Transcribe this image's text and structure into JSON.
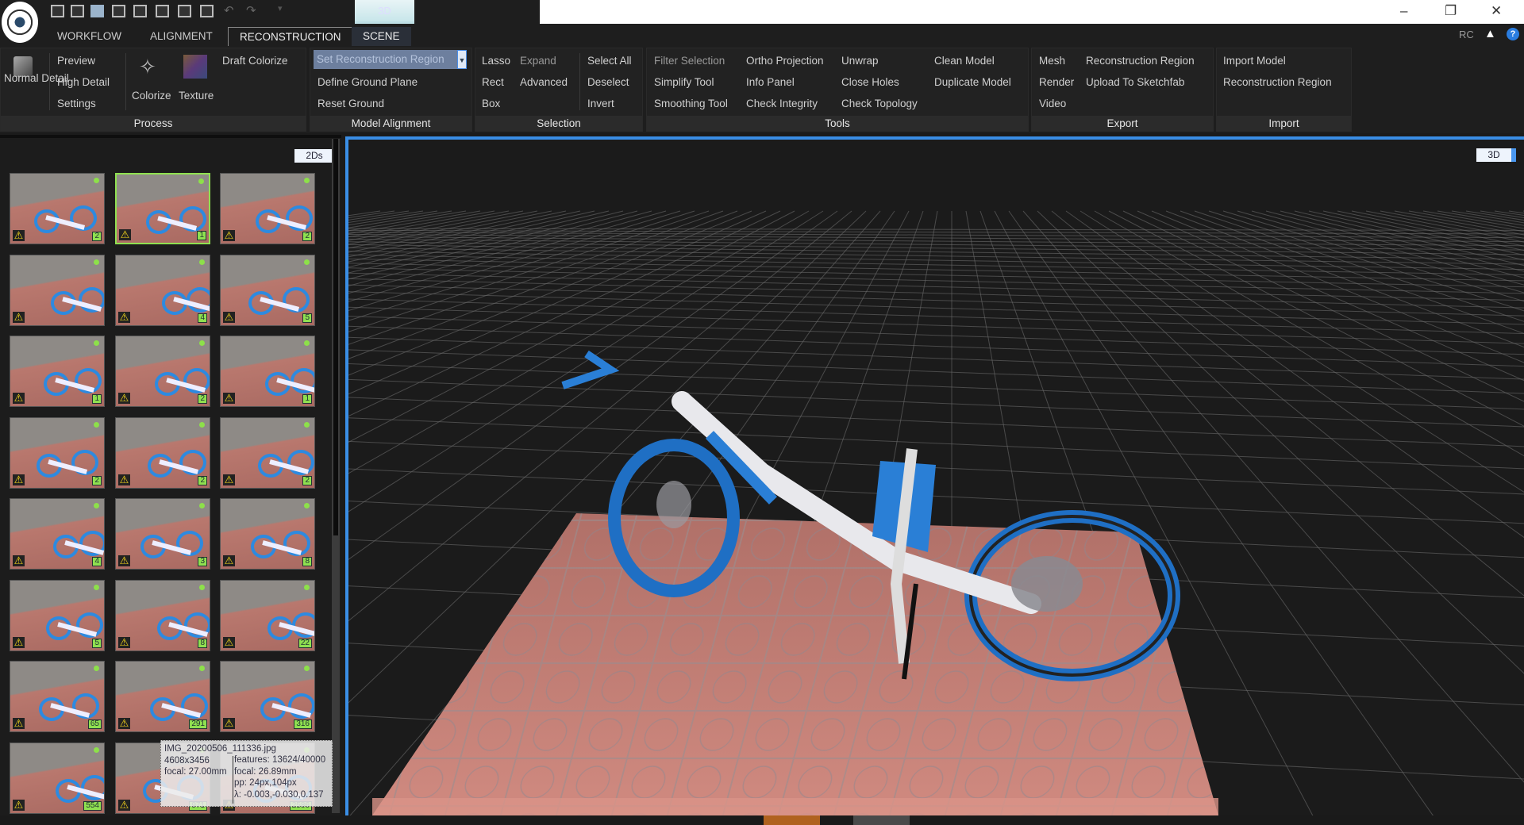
{
  "titlebar": {
    "view_tab": "3D",
    "rc_label": "RC",
    "window_controls": [
      "minimize",
      "restore",
      "close"
    ]
  },
  "tabs": [
    {
      "label": "WORKFLOW"
    },
    {
      "label": "ALIGNMENT"
    },
    {
      "label": "RECONSTRUCTION",
      "active": true
    },
    {
      "label": "SCENE"
    }
  ],
  "ribbon": {
    "process": {
      "label": "Process",
      "normal_detail": "Normal Detail",
      "preview": "Preview",
      "high_detail": "High Detail",
      "settings": "Settings",
      "colorize": "Colorize",
      "texture": "Texture",
      "draft_colorize": "Draft Colorize"
    },
    "model_alignment": {
      "label": "Model Alignment",
      "dropdown_value": "Set Reconstruction Region",
      "define_ground": "Define Ground Plane",
      "reset_ground": "Reset Ground"
    },
    "selection": {
      "label": "Selection",
      "lasso": "Lasso",
      "expand": "Expand",
      "rect": "Rect",
      "advanced": "Advanced",
      "box": "Box",
      "select_all": "Select All",
      "deselect": "Deselect",
      "invert": "Invert"
    },
    "tools": {
      "label": "Tools",
      "filter_selection": "Filter Selection",
      "simplify": "Simplify Tool",
      "smoothing": "Smoothing Tool",
      "ortho": "Ortho Projection",
      "info_panel": "Info Panel",
      "check_integrity": "Check Integrity",
      "unwrap": "Unwrap",
      "close_holes": "Close Holes",
      "check_topology": "Check Topology",
      "clean_model": "Clean Model",
      "duplicate_model": "Duplicate Model"
    },
    "export": {
      "label": "Export",
      "mesh": "Mesh",
      "render": "Render",
      "video": "Video",
      "recon_region": "Reconstruction Region",
      "sketchfab": "Upload To Sketchfab"
    },
    "import": {
      "label": "Import",
      "import_model": "Import Model",
      "recon_region": "Reconstruction Region"
    }
  },
  "images_panel": {
    "view_label": "2Ds",
    "selected_index": 1,
    "badges": [
      "2",
      "1",
      "2",
      "",
      "4",
      "5",
      "1",
      "2",
      "1",
      "2",
      "2",
      "2",
      "4",
      "3",
      "8",
      "5",
      "8",
      "22",
      "65",
      "291",
      "316",
      "554",
      "971",
      "2586"
    ]
  },
  "tooltip": {
    "filename": "IMG_20200506_111336.jpg",
    "resolution": "4608x3456",
    "focal_exif": "focal: 27.00mm",
    "features": "features: 13624/40000",
    "focal_est": "focal: 26.89mm",
    "pp": "pp: 24px,104px",
    "distortion": "λ: -0.003,-0.030,0.137"
  },
  "viewport": {
    "view_label": "3D"
  },
  "colors": {
    "accent": "#3a8ee6",
    "badge": "#8fe050",
    "warning": "#f3d51a",
    "bike_blue": "#2d8ae0",
    "status_orange": "#b0621f"
  }
}
